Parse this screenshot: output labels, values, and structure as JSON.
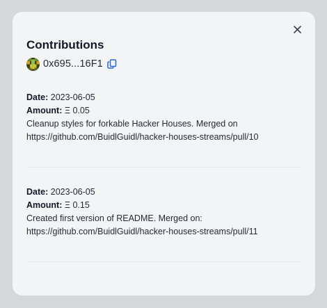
{
  "modal": {
    "title": "Contributions",
    "address": "0x695...16F1",
    "close_symbol": "×"
  },
  "contributions": [
    {
      "date_label": "Date:",
      "date": "2023-06-05",
      "amount_label": "Amount:",
      "amount": "Ξ 0.05",
      "description": "Cleanup styles for forkable Hacker Houses. Merged on",
      "link": "https://github.com/BuidlGuidl/hacker-houses-streams/pull/10"
    },
    {
      "date_label": "Date:",
      "date": "2023-06-05",
      "amount_label": "Amount:",
      "amount": "Ξ 0.15",
      "description": "Created first version of README. Merged on:",
      "link": "https://github.com/BuidlGuidl/hacker-houses-streams/pull/11"
    }
  ],
  "colors": {
    "backdrop": "#d6d7db",
    "modal_bg": "#f3f4f6",
    "copy_icon": "#2563eb"
  },
  "icons": [
    "close-icon",
    "avatar",
    "copy-icon"
  ]
}
